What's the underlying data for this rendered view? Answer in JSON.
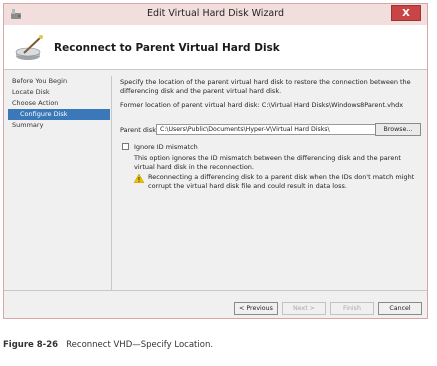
{
  "window": {
    "title": "Edit Virtual Hard Disk Wizard",
    "close_label": "X"
  },
  "header": {
    "title": "Reconnect to Parent Virtual Hard Disk"
  },
  "nav": {
    "items": [
      {
        "label": "Before You Begin",
        "selected": false
      },
      {
        "label": "Locate Disk",
        "selected": false
      },
      {
        "label": "Choose Action",
        "selected": false
      },
      {
        "label": "Configure Disk",
        "selected": true
      },
      {
        "label": "Summary",
        "selected": false
      }
    ]
  },
  "content": {
    "intro": "Specify the location of the parent virtual hard disk to restore the connection between the differencing disk and the parent virtual hard disk.",
    "former_location": "Former location of parent virtual hard disk: C:\\Virtual Hard Disks\\Windows8Parent.vhdx",
    "parent_label": "Parent disk:",
    "parent_value": "C:\\Users\\Public\\Documents\\Hyper-V\\Virtual Hard Disks\\",
    "browse_label": "Browse...",
    "ignore_label": "Ignore ID mismatch",
    "ignore_checked": false,
    "ignore_desc": "This option ignores the ID mismatch between the differencing disk and the parent virtual hard disk in the reconnection.",
    "warning": "Reconnecting a differencing disk to a parent disk when the IDs don't match might corrupt the virtual hard disk file and could result in data loss."
  },
  "buttons": {
    "previous": "< Previous",
    "next": "Next >",
    "finish": "Finish",
    "cancel": "Cancel"
  },
  "caption": {
    "figure": "Figure 8-26",
    "text": "Reconnect VHD—Specify Location."
  },
  "colors": {
    "accent": "#3a78b9",
    "close": "#c94444",
    "warning": "#f2c200"
  }
}
